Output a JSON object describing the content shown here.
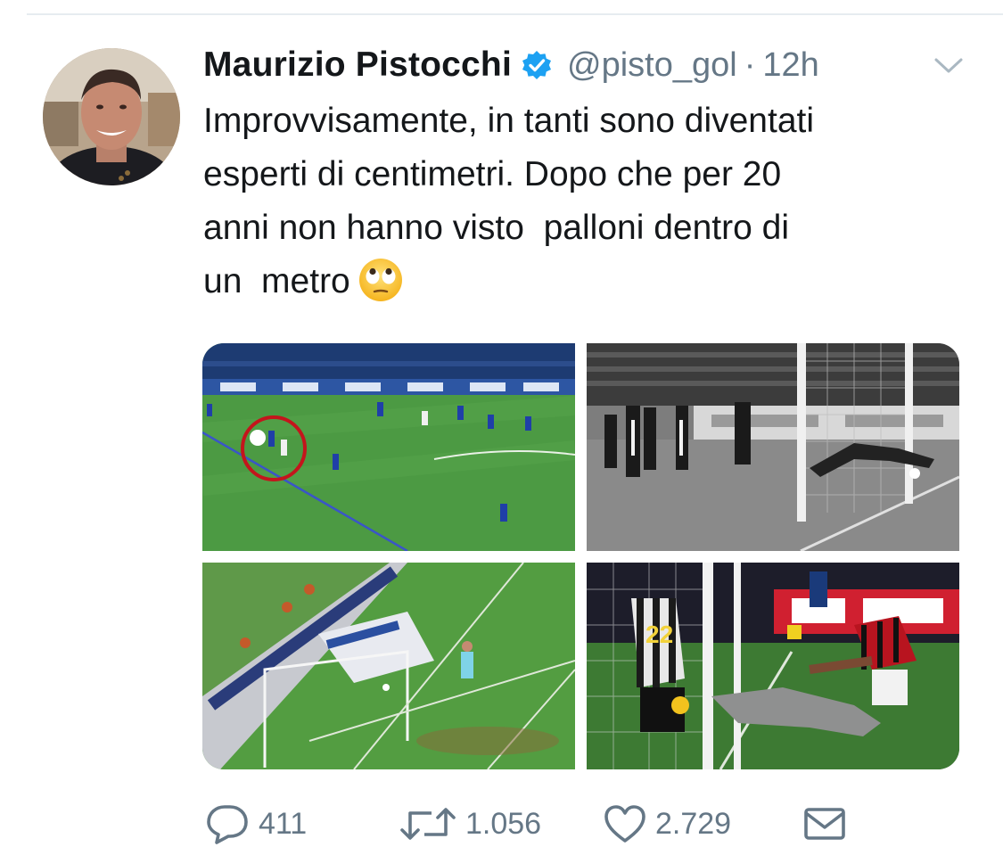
{
  "tweet": {
    "author_name": "Maurizio Pistocchi",
    "handle": "@pisto_gol",
    "separator": "·",
    "time": "12h",
    "text": "Improvvisamente, in tanti sono diventati\nesperti di centimetri. Dopo che per 20\nanni non hanno visto  palloni dentro di\nun  metro",
    "emoji": "face-with-rolling-eyes"
  },
  "icons": {
    "verified": "verified-badge-icon",
    "caret": "chevron-down-icon",
    "reply": "reply-icon",
    "retweet": "retweet-icon",
    "like": "heart-icon",
    "share": "mail-icon"
  },
  "actions": {
    "reply_count": "411",
    "retweet_count": "1.056",
    "like_count": "2.729"
  },
  "colors": {
    "name": "#14171a",
    "secondary": "#657786",
    "verified": "#1da1f2"
  }
}
